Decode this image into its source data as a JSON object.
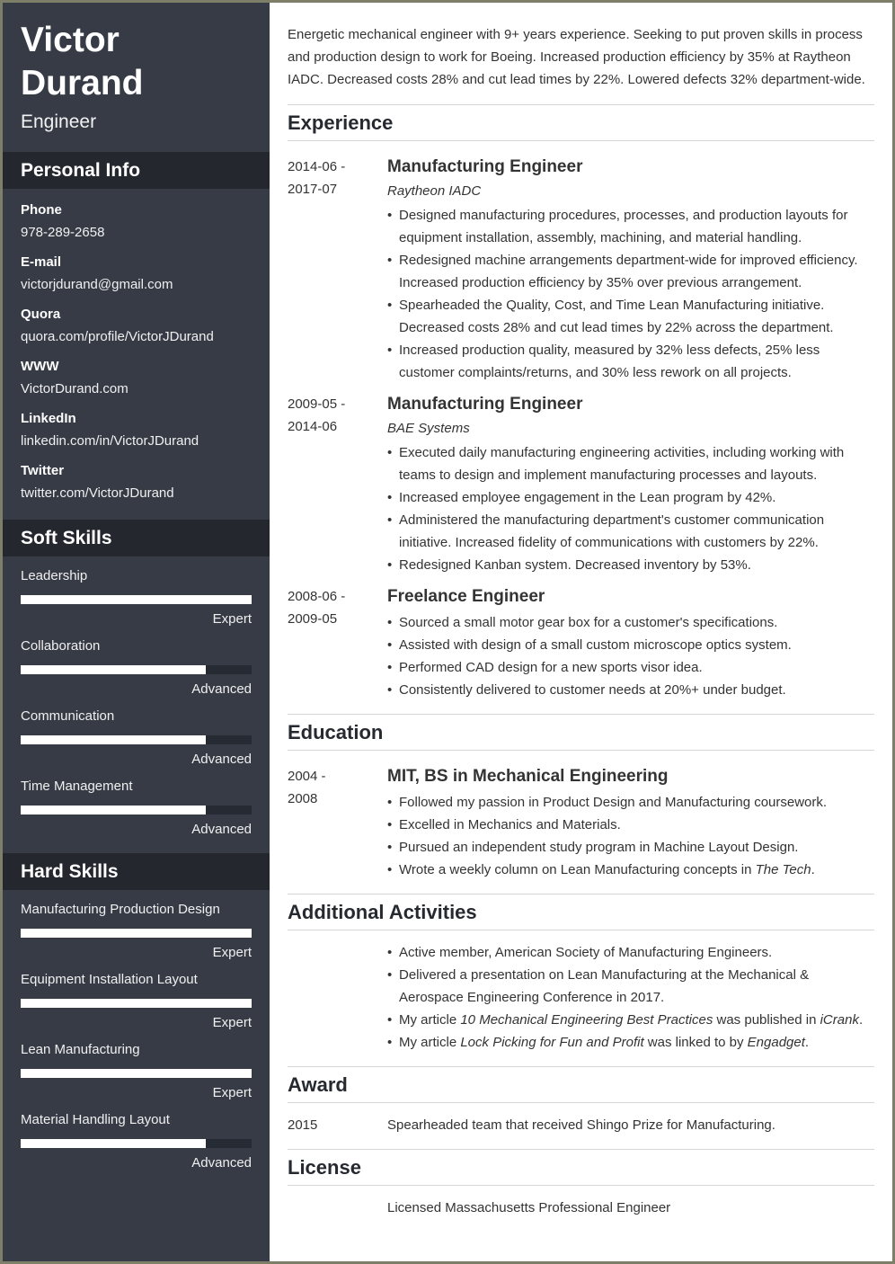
{
  "profile": {
    "first_name": "Victor",
    "last_name": "Durand",
    "role": "Engineer"
  },
  "sidebar": {
    "personal_info": {
      "heading": "Personal Info",
      "items": [
        {
          "label": "Phone",
          "value": "978-289-2658"
        },
        {
          "label": "E-mail",
          "value": "victorjdurand@gmail.com"
        },
        {
          "label": "Quora",
          "value": "quora.com/profile/VictorJDurand"
        },
        {
          "label": "WWW",
          "value": "VictorDurand.com"
        },
        {
          "label": "LinkedIn",
          "value": "linkedin.com/in/VictorJDurand"
        },
        {
          "label": "Twitter",
          "value": "twitter.com/VictorJDurand"
        }
      ]
    },
    "soft_skills": {
      "heading": "Soft Skills",
      "items": [
        {
          "name": "Leadership",
          "level": "Expert",
          "fill_percent": 100
        },
        {
          "name": "Collaboration",
          "level": "Advanced",
          "fill_percent": 80
        },
        {
          "name": "Communication",
          "level": "Advanced",
          "fill_percent": 80
        },
        {
          "name": "Time Management",
          "level": "Advanced",
          "fill_percent": 80
        }
      ]
    },
    "hard_skills": {
      "heading": "Hard Skills",
      "items": [
        {
          "name": "Manufacturing Production Design",
          "level": "Expert",
          "fill_percent": 100
        },
        {
          "name": "Equipment Installation Layout",
          "level": "Expert",
          "fill_percent": 100
        },
        {
          "name": "Lean Manufacturing",
          "level": "Expert",
          "fill_percent": 100
        },
        {
          "name": "Material Handling Layout",
          "level": "Advanced",
          "fill_percent": 80
        }
      ]
    }
  },
  "main": {
    "summary": "Energetic mechanical engineer with 9+ years experience. Seeking to put proven skills in process and production design to work for Boeing. Increased production efficiency by 35% at Raytheon IADC. Decreased costs 28% and cut lead times by 22%. Lowered defects 32% department-wide.",
    "experience": {
      "heading": "Experience",
      "entries": [
        {
          "date_start": "2014-06 -",
          "date_end": "2017-07",
          "title": "Manufacturing Engineer",
          "org": "Raytheon IADC",
          "bullets": [
            "Designed manufacturing procedures, processes, and production layouts for equipment installation, assembly, machining, and material handling.",
            "Redesigned machine arrangements department-wide for improved efficiency. Increased production efficiency by 35% over previous arrangement.",
            "Spearheaded the Quality, Cost, and Time Lean Manufacturing initiative. Decreased costs 28% and cut lead times by 22% across the department.",
            "Increased production quality, measured by 32% less defects, 25% less customer complaints/returns, and 30% less rework on all projects."
          ]
        },
        {
          "date_start": "2009-05 -",
          "date_end": "2014-06",
          "title": "Manufacturing Engineer",
          "org": "BAE Systems",
          "bullets": [
            "Executed daily manufacturing engineering activities, including working with teams to design and implement manufacturing processes and layouts.",
            "Increased employee engagement in the Lean program by 42%.",
            "Administered the manufacturing department's customer communication initiative. Increased fidelity of communications with customers by 22%.",
            "Redesigned Kanban system. Decreased inventory by 53%."
          ]
        },
        {
          "date_start": "2008-06 -",
          "date_end": "2009-05",
          "title": "Freelance Engineer",
          "bullets": [
            "Sourced a small motor gear box for a customer's specifications.",
            "Assisted with design of a small custom microscope optics system.",
            "Performed CAD design for a new sports visor idea.",
            "Consistently delivered to customer needs at 20%+ under budget."
          ]
        }
      ]
    },
    "education": {
      "heading": "Education",
      "entry": {
        "date_start": "2004 -",
        "date_end": "2008",
        "title": "MIT, BS in Mechanical Engineering",
        "bullets": [
          "Followed my passion in Product Design and Manufacturing coursework.",
          "Excelled in Mechanics and Materials.",
          "Pursued an independent study program in Machine Layout Design."
        ],
        "last_bullet": {
          "prefix": "Wrote a weekly column on Lean Manufacturing concepts in ",
          "italic": "The Tech",
          "suffix": "."
        }
      }
    },
    "activities": {
      "heading": "Additional Activities",
      "bullets": [
        "Active member, American Society of Manufacturing Engineers.",
        "Delivered a presentation on Lean Manufacturing at the Mechanical & Aerospace Engineering Conference in 2017."
      ],
      "article1": {
        "prefix": "My article ",
        "title": "10 Mechanical Engineering Best Practices",
        "middle": " was published in ",
        "pub": "iCrank",
        "suffix": "."
      },
      "article2": {
        "prefix": "My article ",
        "title": "Lock Picking for Fun and Profit",
        "middle": " was linked to by ",
        "pub": "Engadget",
        "suffix": "."
      }
    },
    "award": {
      "heading": "Award",
      "year": "2015",
      "text": "Spearheaded team that received Shingo Prize for Manufacturing."
    },
    "license": {
      "heading": "License",
      "text": "Licensed Massachusetts Professional Engineer"
    }
  }
}
